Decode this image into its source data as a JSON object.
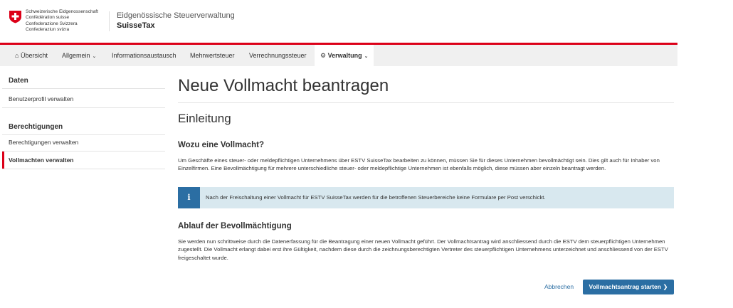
{
  "header": {
    "confederation": [
      "Schweizerische Eidgenossenschaft",
      "Confédération suisse",
      "Confederazione Svizzera",
      "Confederaziun svizra"
    ],
    "agency": "Eidgenössische Steuerverwaltung",
    "app_name": "SuisseTax",
    "brand_color": "#dc0018"
  },
  "nav": {
    "items": [
      {
        "label": "Übersicht",
        "icon": "home-icon"
      },
      {
        "label": "Allgemein",
        "dropdown": true
      },
      {
        "label": "Informationsaustausch"
      },
      {
        "label": "Mehrwertsteuer"
      },
      {
        "label": "Verrechnungssteuer"
      },
      {
        "label": "Verwaltung",
        "icon": "gear-icon",
        "dropdown": true,
        "active": true
      }
    ]
  },
  "sidebar": {
    "sections": [
      {
        "title": "Daten",
        "links": [
          "Benutzerprofil verwalten"
        ]
      },
      {
        "title": "Berechtigungen",
        "links": [
          "Berechtigungen verwalten",
          "Vollmachten verwalten"
        ]
      }
    ],
    "active_link": "Vollmachten verwalten"
  },
  "main": {
    "title": "Neue Vollmacht beantragen",
    "section_title": "Einleitung",
    "why_heading": "Wozu eine Vollmacht?",
    "why_text": "Um Geschäfte eines steuer- oder meldepflichtigen Unternehmens über ESTV SuisseTax bearbeiten zu können, müssen Sie für dieses Unternehmen bevollmächtigt sein. Dies gilt auch für Inhaber von Einzelfirmen. Eine Bevollmächtigung für mehrere unterschiedliche steuer- oder meldepflichtige Unternehmen ist ebenfalls möglich, diese müssen aber einzeln beantragt werden.",
    "info_text": "Nach der Freischaltung einer Vollmacht für ESTV SuisseTax werden für die betroffenen Steuerbereiche keine Formulare per Post verschickt.",
    "process_heading": "Ablauf der Bevollmächtigung",
    "process_text": "Sie werden nun schrittweise durch die Datenerfassung für die Beantragung einer neuen Vollmacht geführt. Der Vollmachtsantrag wird anschliessend durch die ESTV dem steuerpflichtigen Unternehmen zugestellt. Die Vollmacht erlangt dabei erst ihre Gültigkeit, nachdem diese durch die zeichnungsberechtigten Vertreter des steuerpflichtigen Unternehmens unterzeichnet und anschliessend von der ESTV freigeschaltet wurde."
  },
  "actions": {
    "cancel_label": "Abbrechen",
    "start_label": "Vollmachtsantrag starten",
    "primary_color": "#2b6ea3"
  }
}
